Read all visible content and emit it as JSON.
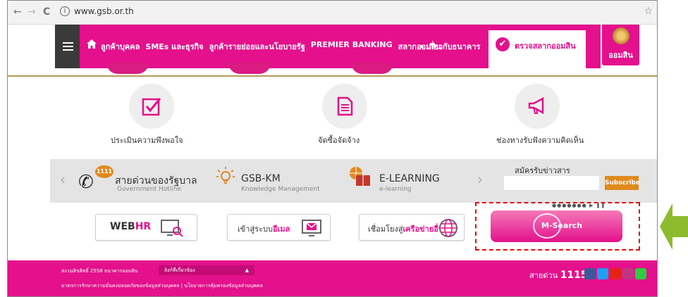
{
  "browser": {
    "back": "←",
    "forward": "→",
    "reload": "C",
    "info": "i",
    "url": "www.gsb.or.th",
    "bookmark": "☆"
  },
  "header": {
    "menu_items": [
      "ลูกค้าบุคคล",
      "SMEs และธุรกิจ",
      "ลูกค้ารายย่อยและนโยบายรัฐ",
      "PREMIER BANKING",
      "สลากออมสิน"
    ],
    "about": "• เกี่ยวกับธนาคาร",
    "lottery_check": "ตรวจสลากออมสิน",
    "logo_text": "ออมสิน"
  },
  "services": [
    {
      "label": "ประเมินความพึงพอใจ",
      "icon": "checkbox-icon"
    },
    {
      "label": "จัดซื้อจัดจ้าง",
      "icon": "document-icon"
    },
    {
      "label": "ช่องทางรับฟังความคิดเห็น",
      "icon": "megaphone-icon"
    }
  ],
  "band": {
    "hotline_badge": "1111",
    "hotline_title": "สายด่วนของรัฐบาล",
    "hotline_sub": "Government Hotline",
    "km_title": "GSB-KM",
    "km_sub": "Knowledge Management",
    "el_title": "E-LEARNING",
    "el_sub": "e-learning",
    "newsletter_label": "สมัครรับข่าวสาร",
    "subscribe": "Subscribe"
  },
  "links": {
    "webhr_a": "WEB",
    "webhr_b": "HR",
    "email_a": "เข้าสู่ระบบ",
    "email_b": "อีเมล",
    "network_a": "เชื่อมโยงสู่",
    "network_b": "เครือข่ายอื่น",
    "msearch": "M-Search",
    "dots": "●●●●●●● ▶ ❚❚"
  },
  "footer": {
    "copyright": "สงวนลิขสิทธิ์ 2558 ธนาคารออมสิน",
    "related": "ลิงก์ที่เกี่ยวข้อง",
    "privacy": "มาตรการรักษาความมั่นคงปลอดภัยของข้อมูลส่วนบุคคล  |  นโยบายการคุ้มครองข้อมูลส่วนบุคคล",
    "hotline_label": "สายด่วน",
    "hotline_number": "1115"
  },
  "colors": {
    "brand_pink": "#e4108c",
    "accent_orange": "#e08a1e",
    "highlight_red": "#e10d0d",
    "arrow_green": "#8dbb2e"
  }
}
